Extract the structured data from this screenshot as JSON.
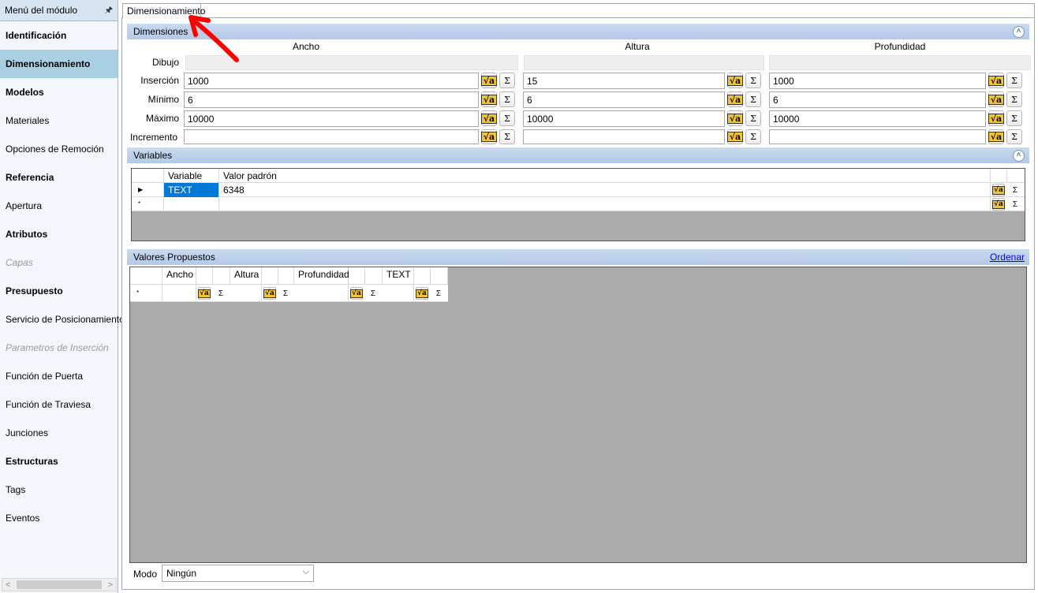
{
  "sidebar": {
    "title": "Menú del módulo",
    "pin_icon": "pin-icon",
    "items": [
      {
        "label": "Identificación",
        "style": "bold"
      },
      {
        "label": "Dimensionamiento",
        "style": "bold-active"
      },
      {
        "label": "Modelos",
        "style": "bold"
      },
      {
        "label": "Materiales",
        "style": "normal"
      },
      {
        "label": "Opciones de Remoción",
        "style": "normal"
      },
      {
        "label": "Referencia",
        "style": "bold"
      },
      {
        "label": "Apertura",
        "style": "normal"
      },
      {
        "label": "Atributos",
        "style": "bold"
      },
      {
        "label": "Capas",
        "style": "disabled"
      },
      {
        "label": "Presupuesto",
        "style": "bold"
      },
      {
        "label": "Servicio de Posicionamiento",
        "style": "normal"
      },
      {
        "label": "Parametros de Inserción",
        "style": "disabled"
      },
      {
        "label": "Función de Puerta",
        "style": "normal"
      },
      {
        "label": "Función de Traviesa",
        "style": "normal"
      },
      {
        "label": "Junciones",
        "style": "normal"
      },
      {
        "label": "Estructuras",
        "style": "bold"
      },
      {
        "label": "Tags",
        "style": "normal"
      },
      {
        "label": "Eventos",
        "style": "normal"
      }
    ],
    "scroll_left": "<",
    "scroll_right": ">"
  },
  "tabs": {
    "active": "Dimensionamiento"
  },
  "dimensiones": {
    "title": "Dimensiones",
    "collapse_icon": "double-chevron-up-icon",
    "columns": [
      "Ancho",
      "Altura",
      "Profundidad"
    ],
    "row_labels": {
      "dibujo": "Dibujo",
      "insercion": "Inserción",
      "minimo": "Mínimo",
      "maximo": "Máximo",
      "incremento": "Incremento"
    },
    "values": {
      "insercion": [
        "1000",
        "15",
        "1000"
      ],
      "minimo": [
        "6",
        "6",
        "6"
      ],
      "maximo": [
        "10000",
        "10000",
        "10000"
      ],
      "incremento": [
        "",
        "",
        ""
      ]
    },
    "sqrt_button_glyph": "√a",
    "sum_button_glyph": "Σ"
  },
  "variables": {
    "title": "Variables",
    "collapse_icon": "double-chevron-up-icon",
    "headers": [
      "Variable",
      "Valor padrón"
    ],
    "rows": [
      {
        "marker": "▶",
        "variable": "TEXT",
        "valor": "6348"
      }
    ],
    "new_row_marker": "*"
  },
  "valores_propuestos": {
    "title": "Valores Propuestos",
    "sort_link": "Ordenar",
    "headers": [
      "Ancho",
      "Altura",
      "Profundidad",
      "TEXT"
    ],
    "new_row_marker": "*"
  },
  "modo": {
    "label": "Modo",
    "value": "Ningún"
  },
  "colors": {
    "accent_selection": "#0078d7",
    "active_menu": "#a9cfe3",
    "section_header": "#b2c9e6",
    "annotation_arrow": "#ff0000"
  }
}
